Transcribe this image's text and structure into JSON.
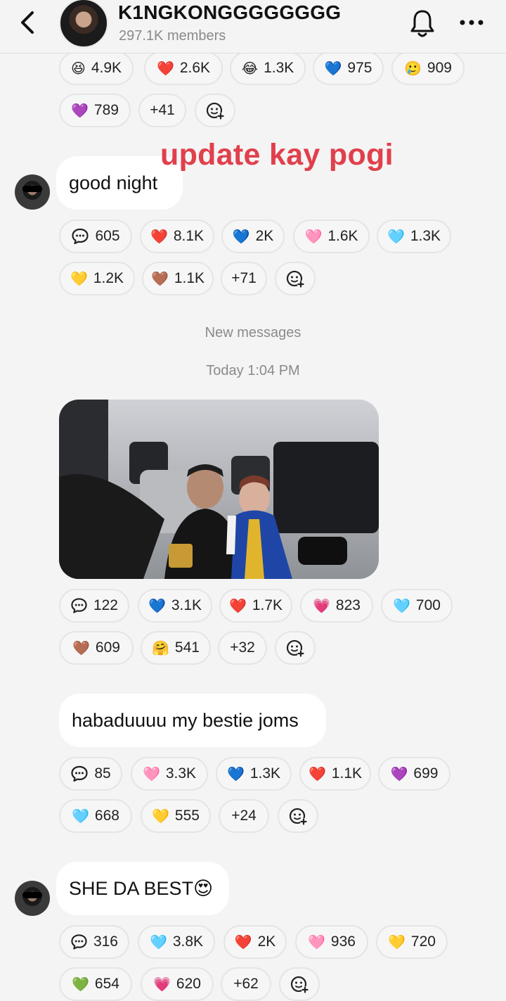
{
  "header": {
    "group_name": "K1NGKONGGGGGGGG",
    "members": "297.1K members"
  },
  "overlay_caption": "update kay pogi",
  "messages": [
    {
      "rows": [
        [
          {
            "emoji": "😆",
            "count": "4.9K"
          },
          {
            "emoji": "❤️",
            "count": "2.6K"
          },
          {
            "emoji": "😂",
            "count": "1.3K"
          },
          {
            "emoji": "💙",
            "count": "975"
          },
          {
            "emoji": "🥲",
            "count": "909"
          }
        ],
        [
          {
            "emoji": "💜",
            "count": "789"
          },
          {
            "emoji": "",
            "count": "+41"
          }
        ]
      ]
    },
    {
      "text": "good night",
      "rows": [
        [
          {
            "emoji": "💬",
            "count": "605"
          },
          {
            "emoji": "❤️",
            "count": "8.1K"
          },
          {
            "emoji": "💙",
            "count": "2K"
          },
          {
            "emoji": "🩷",
            "count": "1.6K"
          },
          {
            "emoji": "🩵",
            "count": "1.3K"
          }
        ],
        [
          {
            "emoji": "💛",
            "count": "1.2K"
          },
          {
            "emoji": "🤎",
            "count": "1.1K"
          },
          {
            "emoji": "",
            "count": "+71"
          }
        ]
      ]
    },
    {
      "rows": [
        [
          {
            "emoji": "💬",
            "count": "122"
          },
          {
            "emoji": "💙",
            "count": "3.1K"
          },
          {
            "emoji": "❤️",
            "count": "1.7K"
          },
          {
            "emoji": "💗",
            "count": "823"
          },
          {
            "emoji": "🩵",
            "count": "700"
          }
        ],
        [
          {
            "emoji": "🤎",
            "count": "609"
          },
          {
            "emoji": "🤗",
            "count": "541"
          },
          {
            "emoji": "",
            "count": "+32"
          }
        ]
      ]
    },
    {
      "text": "habaduuuu my bestie joms",
      "rows": [
        [
          {
            "emoji": "💬",
            "count": "85"
          },
          {
            "emoji": "🩷",
            "count": "3.3K"
          },
          {
            "emoji": "💙",
            "count": "1.3K"
          },
          {
            "emoji": "❤️",
            "count": "1.1K"
          },
          {
            "emoji": "💜",
            "count": "699"
          }
        ],
        [
          {
            "emoji": "🩵",
            "count": "668"
          },
          {
            "emoji": "💛",
            "count": "555"
          },
          {
            "emoji": "",
            "count": "+24"
          }
        ]
      ]
    },
    {
      "text": "SHE DA BEST😍",
      "rows": [
        [
          {
            "emoji": "💬",
            "count": "316"
          },
          {
            "emoji": "🩵",
            "count": "3.8K"
          },
          {
            "emoji": "❤️",
            "count": "2K"
          },
          {
            "emoji": "🩷",
            "count": "936"
          },
          {
            "emoji": "💛",
            "count": "720"
          }
        ],
        [
          {
            "emoji": "💚",
            "count": "654"
          },
          {
            "emoji": "💗",
            "count": "620"
          },
          {
            "emoji": "",
            "count": "+62"
          }
        ]
      ]
    }
  ],
  "system": {
    "new_messages": "New messages",
    "timestamp": "Today 1:04 PM"
  }
}
